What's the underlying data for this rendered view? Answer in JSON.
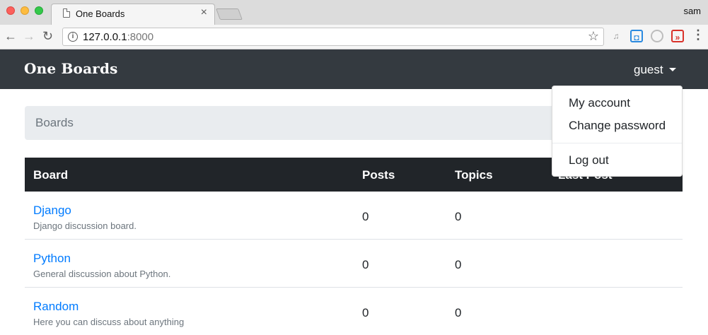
{
  "browser": {
    "tab_title": "One Boards",
    "tab_close": "×",
    "user": "sam",
    "url_host": "127.0.0.1",
    "url_port": ":8000",
    "back_glyph": "←",
    "forward_glyph": "→",
    "reload_glyph": "↻",
    "info_glyph": "i",
    "star_glyph": "☆",
    "menu_glyph": "⋮",
    "extensions": [
      "music-note-icon",
      "camera-extension-icon",
      "circle-extension-icon",
      "red-play-extension-icon"
    ]
  },
  "navbar": {
    "brand": "One Boards",
    "user_toggle": "guest",
    "background": "#343a40"
  },
  "breadcrumb": {
    "current": "Boards"
  },
  "table": {
    "headers": [
      "Board",
      "Posts",
      "Topics",
      "Last Post"
    ],
    "rows": [
      {
        "name": "Django",
        "description": "Django discussion board.",
        "posts": "0",
        "topics": "0"
      },
      {
        "name": "Python",
        "description": "General discussion about Python.",
        "posts": "0",
        "topics": "0"
      },
      {
        "name": "Random",
        "description": "Here you can discuss about anything",
        "posts": "0",
        "topics": "0"
      }
    ]
  },
  "dropdown": {
    "items": [
      "My account",
      "Change password",
      "Log out"
    ]
  },
  "colors": {
    "link": "#007bff",
    "table_header": "#212529",
    "muted": "#6c757d"
  }
}
